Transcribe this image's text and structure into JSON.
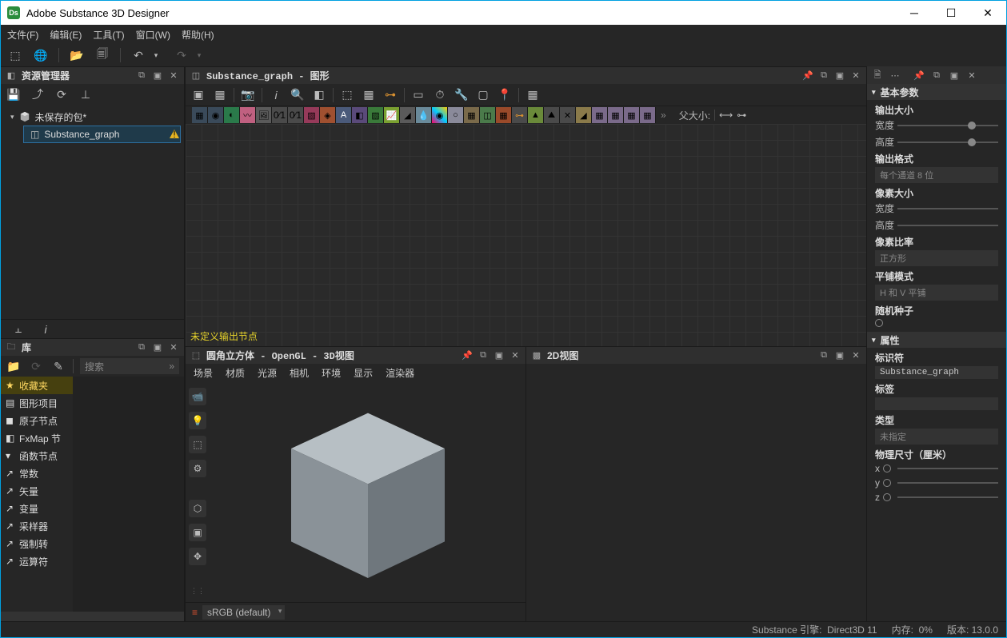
{
  "titlebar": {
    "title": "Adobe Substance 3D Designer"
  },
  "menubar": [
    "文件(F)",
    "编辑(E)",
    "工具(T)",
    "窗口(W)",
    "帮助(H)"
  ],
  "explorer": {
    "title": "资源管理器",
    "pkg": "未保存的包*",
    "graph": "Substance_graph"
  },
  "library": {
    "title": "库",
    "search_placeholder": "搜索",
    "cats": [
      {
        "icon": "★",
        "label": "收藏夹",
        "star": true
      },
      {
        "icon": "▤",
        "label": "图形项目"
      },
      {
        "icon": "◼",
        "label": "原子节点"
      },
      {
        "icon": "◧",
        "label": "FxMap 节"
      },
      {
        "icon": "▾",
        "label": "函数节点",
        "hdr": true
      },
      {
        "icon": "↗",
        "label": "常数"
      },
      {
        "icon": "↗",
        "label": "矢量"
      },
      {
        "icon": "↗",
        "label": "变量"
      },
      {
        "icon": "↗",
        "label": "采样器"
      },
      {
        "icon": "↗",
        "label": "强制转"
      },
      {
        "icon": "↗",
        "label": "运算符"
      }
    ]
  },
  "graph": {
    "title": "Substance_graph - 图形",
    "warn": "未定义输出节点",
    "parent_size": "父大小:"
  },
  "view3d": {
    "title": "圆角立方体 - OpenGL - 3D视图",
    "menus": [
      "场景",
      "材质",
      "光源",
      "相机",
      "环境",
      "显示",
      "渲染器"
    ],
    "colorspace": "sRGB (default)"
  },
  "view2d": {
    "title": "2D视图"
  },
  "props": {
    "sec_basic": "基本参数",
    "output_size": "输出大小",
    "width": "宽度",
    "height": "高度",
    "output_format": "输出格式",
    "format_value": "每个通道 8 位",
    "pixel_size": "像素大小",
    "pixel_ratio": "像素比率",
    "ratio_value": "正方形",
    "tiling_mode": "平铺模式",
    "tiling_value": "H 和 V 平铺",
    "random_seed": "随机种子",
    "sec_attrs": "属性",
    "identifier": "标识符",
    "identifier_value": "Substance_graph",
    "labels": "标签",
    "type": "类型",
    "type_value": "未指定",
    "phys": "物理尺寸（厘米）",
    "x": "x",
    "y": "y",
    "z": "z"
  },
  "status": {
    "engine": "Substance 引擎:",
    "engine_val": "Direct3D 11",
    "mem": "内存:",
    "mem_val": "0%",
    "ver": "版本:",
    "ver_val": "13.0.0"
  }
}
